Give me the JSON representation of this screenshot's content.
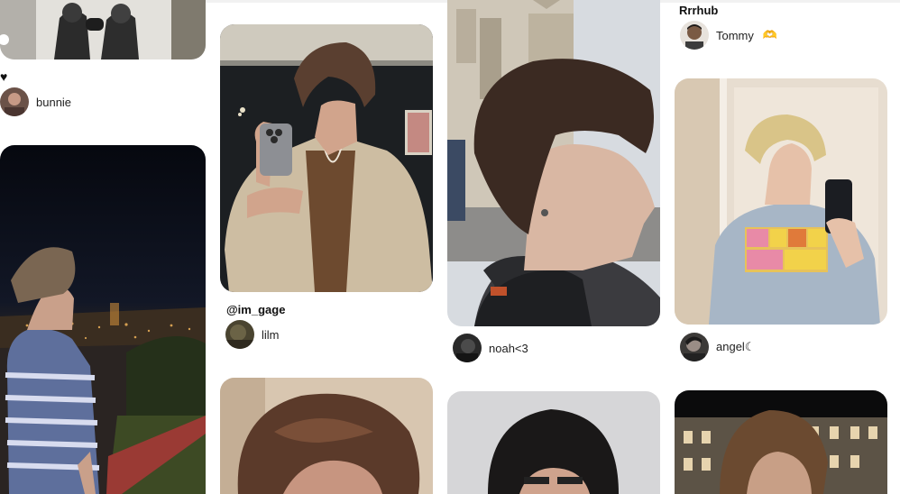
{
  "pins": [
    {
      "id": "p1",
      "title": "",
      "author": "bunnie",
      "has_heart": true,
      "image": "two-boxers-poster-photo"
    },
    {
      "id": "p2",
      "title": "",
      "author": "",
      "image": "boy-night-city-overlook-photo"
    },
    {
      "id": "p3",
      "title": "@im_gage",
      "author": "lilm",
      "image": "mirror-selfie-tan-jacket-photo"
    },
    {
      "id": "p4",
      "title": "",
      "author": "",
      "image": "messy-hair-closeup-photo"
    },
    {
      "id": "p5",
      "title": "",
      "author": "noah<3",
      "image": "side-profile-headphones-photo"
    },
    {
      "id": "p6",
      "title": "",
      "author": "",
      "image": "hair-closeup-grey-photo"
    },
    {
      "id": "p7",
      "title": "Rrrhub",
      "author": "Tommy",
      "author_emoji": "🫶",
      "image": "header-partial"
    },
    {
      "id": "p8",
      "title": "",
      "author": "angel☾",
      "image": "mirror-selfie-spongebob-hoodie-photo"
    },
    {
      "id": "p9",
      "title": "",
      "author": "",
      "image": "boy-night-building-photo"
    }
  ],
  "colors": {
    "background": "#ffffff",
    "text": "#111111"
  }
}
